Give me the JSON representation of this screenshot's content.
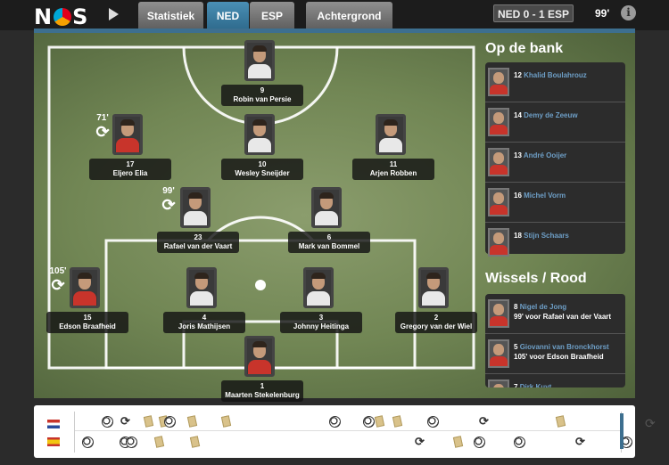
{
  "header": {
    "logo": "NOS",
    "tabs": [
      {
        "label": "Statistiek",
        "active": false
      },
      {
        "label": "NED",
        "active": true
      },
      {
        "label": "ESP",
        "active": false
      },
      {
        "label": "Achtergrond",
        "active": false
      }
    ],
    "score": "NED 0 - 1 ESP",
    "minute": "99'",
    "info_icon": "i"
  },
  "players": [
    {
      "number": "9",
      "name": "Robin van Persie",
      "shirt": "white"
    },
    {
      "number": "17",
      "name": "Eljero Elia",
      "shirt": "red"
    },
    {
      "number": "10",
      "name": "Wesley Sneijder",
      "shirt": "white"
    },
    {
      "number": "11",
      "name": "Arjen Robben",
      "shirt": "white"
    },
    {
      "number": "23",
      "name": "Rafael van der Vaart",
      "shirt": "white"
    },
    {
      "number": "6",
      "name": "Mark van Bommel",
      "shirt": "white"
    },
    {
      "number": "15",
      "name": "Edson Braafheid",
      "shirt": "red"
    },
    {
      "number": "4",
      "name": "Joris Mathijsen",
      "shirt": "white"
    },
    {
      "number": "3",
      "name": "Johnny Heitinga",
      "shirt": "white"
    },
    {
      "number": "2",
      "name": "Gregory van der Wiel",
      "shirt": "white"
    },
    {
      "number": "1",
      "name": "Maarten Stekelenburg",
      "shirt": "red"
    }
  ],
  "substitutions_marks": [
    {
      "minute": "71'"
    },
    {
      "minute": "99'"
    },
    {
      "minute": "105'"
    }
  ],
  "bench": {
    "title": "Op de bank",
    "items": [
      {
        "number": "12",
        "name": "Khalid Boulahrouz"
      },
      {
        "number": "14",
        "name": "Demy de Zeeuw"
      },
      {
        "number": "13",
        "name": "André Ooijer"
      },
      {
        "number": "16",
        "name": "Michel Vorm"
      },
      {
        "number": "18",
        "name": "Stijn Schaars"
      }
    ]
  },
  "subs": {
    "title": "Wissels / Rood",
    "items": [
      {
        "number": "8",
        "name": "Nigel de Jong",
        "detail": "99' voor Rafael van der Vaart"
      },
      {
        "number": "5",
        "name": "Giovanni van Bronckhorst",
        "detail": "105' voor Edson Braafheid"
      },
      {
        "number": "7",
        "name": "Dirk Kuyt",
        "detail": ""
      }
    ]
  },
  "timeline": {
    "flags": [
      "netherlands-flag",
      "spain-flag"
    ],
    "progress_fraction": 0.93
  }
}
